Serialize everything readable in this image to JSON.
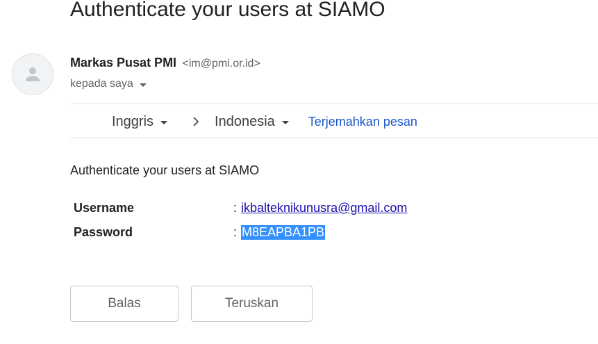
{
  "email": {
    "subject": "Authenticate your users at SIAMO",
    "sender_name": "Markas Pusat PMI",
    "sender_email": "<im@pmi.or.id>",
    "recipient_label": "kepada saya",
    "body_intro": "Authenticate your users at SIAMO",
    "credentials": [
      {
        "label": "Username",
        "colon": ":",
        "value": "ikbalteknikunusra@gmail.com"
      },
      {
        "label": "Password",
        "colon": ":",
        "value": "M8EAPBA1PB"
      }
    ]
  },
  "translate_bar": {
    "source_lang": "Inggris",
    "target_lang": "Indonesia",
    "translate_link": "Terjemahkan pesan"
  },
  "actions": {
    "reply_label": "Balas",
    "forward_label": "Teruskan"
  },
  "icons": {
    "avatar": "person-icon",
    "lang_caret": "caret-down-icon",
    "direction": "chevron-right-icon"
  },
  "colors": {
    "link": "#1a56c8",
    "selection": "#3390ff",
    "muted": "#5f6368"
  }
}
